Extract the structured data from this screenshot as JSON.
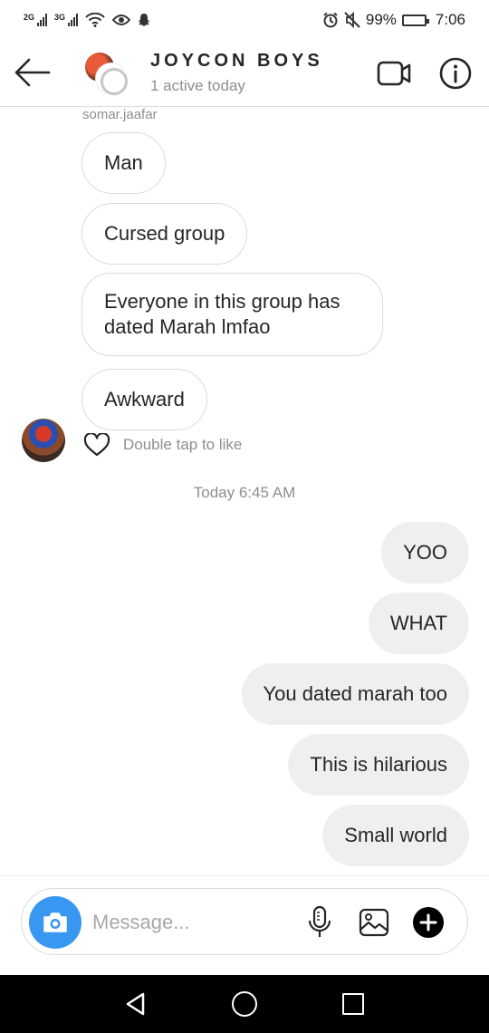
{
  "status_bar": {
    "network1": "2G",
    "network2": "3G",
    "battery": "99%",
    "time": "7:06"
  },
  "header": {
    "title": "JOYCON BOYS",
    "status": "1 active today"
  },
  "conversation": {
    "sender": "somar.jaafar",
    "incoming": [
      "Man",
      "Cursed group",
      "Everyone in this group has dated Marah lmfao",
      "Awkward"
    ],
    "like_hint": "Double tap to like",
    "timestamp": "Today 6:45 AM",
    "outgoing": [
      "YOO",
      "WHAT",
      "You dated marah too",
      "This is hilarious",
      "Small world"
    ]
  },
  "composer": {
    "placeholder": "Message..."
  },
  "colors": {
    "accent": "#3897f0",
    "outgoing_bubble": "#efefef",
    "muted_text": "#8e8e8e"
  },
  "icons": {
    "back": "arrow-left-icon",
    "video": "video-camera-icon",
    "info": "info-icon",
    "like": "heart-icon",
    "camera": "camera-icon",
    "mic": "microphone-icon",
    "gallery": "image-icon",
    "more": "plus-circle-icon"
  }
}
